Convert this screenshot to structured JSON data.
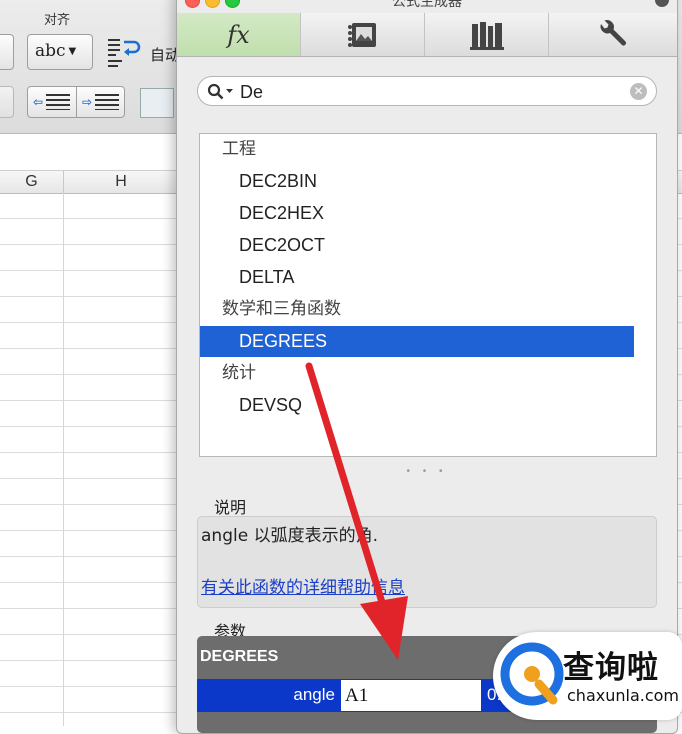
{
  "excel": {
    "ribbon_group_label": "对齐",
    "abc_dropdown_label": "abc",
    "wrap_text_label": "自动",
    "columns": [
      "G",
      "H"
    ]
  },
  "dialog": {
    "title": "公式生成器",
    "tabs": [
      {
        "label": "fx",
        "icon": "function-icon",
        "active": true
      },
      {
        "label": "",
        "icon": "media-browser-icon"
      },
      {
        "label": "",
        "icon": "library-icon"
      },
      {
        "label": "",
        "icon": "wrench-icon"
      }
    ],
    "search": {
      "value": "De",
      "icon": "search-icon"
    },
    "function_list": [
      {
        "kind": "category",
        "label": "工程"
      },
      {
        "kind": "function",
        "label": "DEC2BIN"
      },
      {
        "kind": "function",
        "label": "DEC2HEX"
      },
      {
        "kind": "function",
        "label": "DEC2OCT"
      },
      {
        "kind": "function",
        "label": "DELTA"
      },
      {
        "kind": "category",
        "label": "数学和三角函数"
      },
      {
        "kind": "function",
        "label": "DEGREES",
        "selected": true
      },
      {
        "kind": "category",
        "label": "统计"
      },
      {
        "kind": "function",
        "label": "DEVSQ"
      }
    ],
    "splitter": "• • •",
    "description": {
      "heading": "说明",
      "text": "angle 以弧度表示的角.",
      "help_link": "有关此函数的详细帮助信息"
    },
    "arguments": {
      "heading": "参数",
      "function_name": "DEGREES",
      "rows": [
        {
          "label": "angle",
          "value": "A1",
          "result": "0.8"
        }
      ]
    }
  },
  "colors": {
    "selection": "#1f62d6",
    "arrow": "#e0242a",
    "link": "#1c3fc7",
    "active_tab": "#c1dfad"
  },
  "watermark": {
    "cn": "查询啦",
    "en": "chaxunla.com"
  }
}
